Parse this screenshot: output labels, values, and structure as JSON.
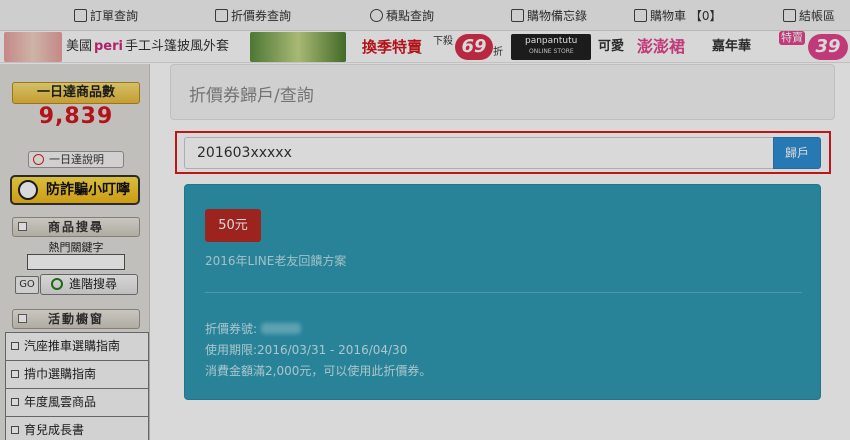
{
  "topnav": {
    "items": [
      {
        "label": "訂單查詢",
        "icon": "document-icon"
      },
      {
        "label": "折價券查詢",
        "icon": "coupon-icon"
      },
      {
        "label": "積點查詢",
        "icon": "points-icon"
      },
      {
        "label": "購物備忘錄",
        "icon": "memo-icon"
      },
      {
        "label": "購物車 【0】",
        "icon": "cart-icon"
      },
      {
        "label": "結帳區",
        "icon": "checkout-icon"
      }
    ]
  },
  "banner": {
    "text1": "美國",
    "text2": "peri",
    "text3": "手工斗篷披風外套",
    "text4": "換季特賣",
    "text5": "下殺",
    "badge1": "69",
    "text6": "折",
    "text7": "panpantutu",
    "text8": "ONLINE STORE",
    "text9": "可愛",
    "text10": "澎澎裙",
    "text11": "嘉年華",
    "text12": "特賣",
    "badge2": "39"
  },
  "sidebar": {
    "badge": "一日達商品數",
    "count": "9,839",
    "explain": "一日達說明",
    "fraud": "防詐騙小叮嚀",
    "search_head": "商品搜尋",
    "keyword_label": "熱門關鍵字",
    "go": "GO",
    "advanced": "進階搜尋",
    "activity_head": "活動櫥窗",
    "list": [
      "汽座推車選購指南",
      "揹巾選購指南",
      "年度風雲商品",
      "育兒成長書"
    ]
  },
  "main": {
    "heading": "折價券歸戶/查詢",
    "search_value": "201603xxxxx",
    "button": "歸戶",
    "coupon": {
      "tag": "50元",
      "name": "2016年LINE老友回饋方案",
      "number_label": "折價券號:",
      "period": "使用期限:2016/03/31 - 2016/04/30",
      "condition": "消費金額滿2,000元，可以使用此折價券。"
    }
  },
  "colors": {
    "accent_red": "#e01b1b",
    "button_blue": "#2e8fd4",
    "coupon_teal": "#2f9ab3",
    "tag_red": "#b92a25",
    "count_red": "#d4161f"
  }
}
